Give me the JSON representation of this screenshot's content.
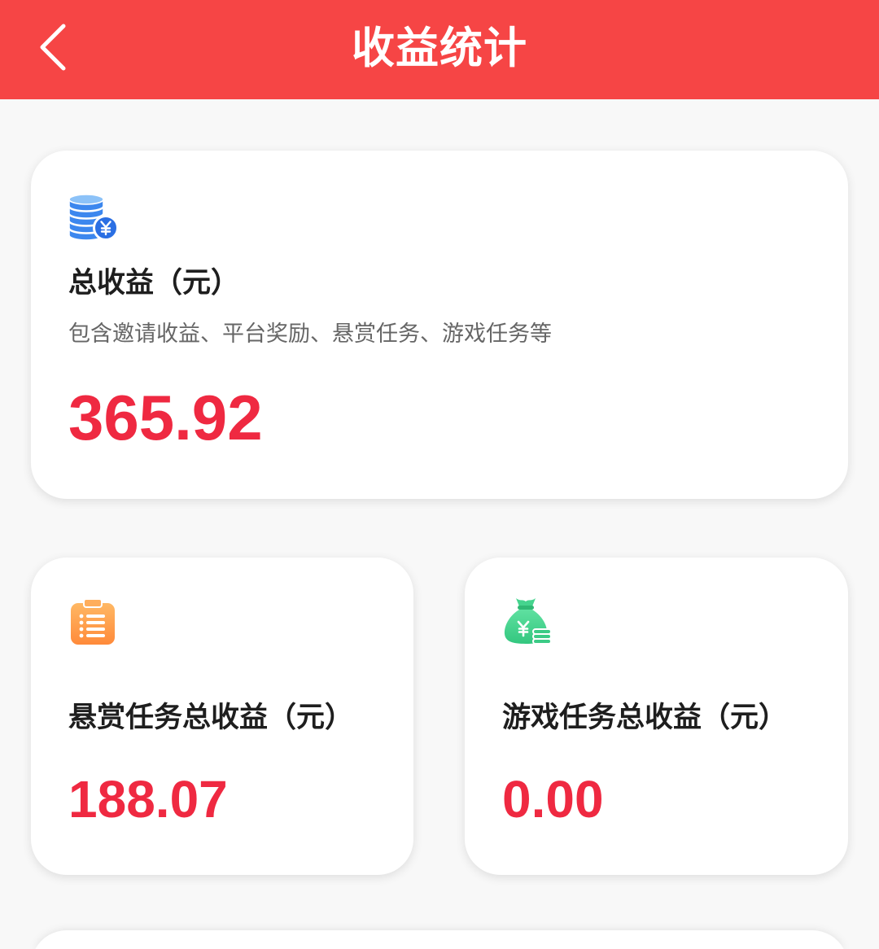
{
  "header": {
    "title": "收益统计",
    "back_icon": "chevron-left-icon"
  },
  "colors": {
    "header_bg": "#F64545",
    "accent_red": "#EF2941",
    "page_bg": "#F8F8F8",
    "label_color": "#1E1E1E",
    "desc_color": "#666666",
    "coin_icon_blue": "#3C87EE",
    "clipboard_icon_orange": "#FF9A45",
    "money_bag_icon_green": "#3FD08A"
  },
  "cards": {
    "total": {
      "icon": "coin-stack-yen-icon",
      "label": "总收益（元）",
      "description": "包含邀请收益、平台奖励、悬赏任务、游戏任务等",
      "value": "365.92"
    },
    "bounty": {
      "icon": "clipboard-list-icon",
      "label": "悬赏任务总收益（元）",
      "value": "188.07"
    },
    "game": {
      "icon": "money-bag-yen-icon",
      "label": "游戏任务总收益（元）",
      "value": "0.00"
    }
  }
}
